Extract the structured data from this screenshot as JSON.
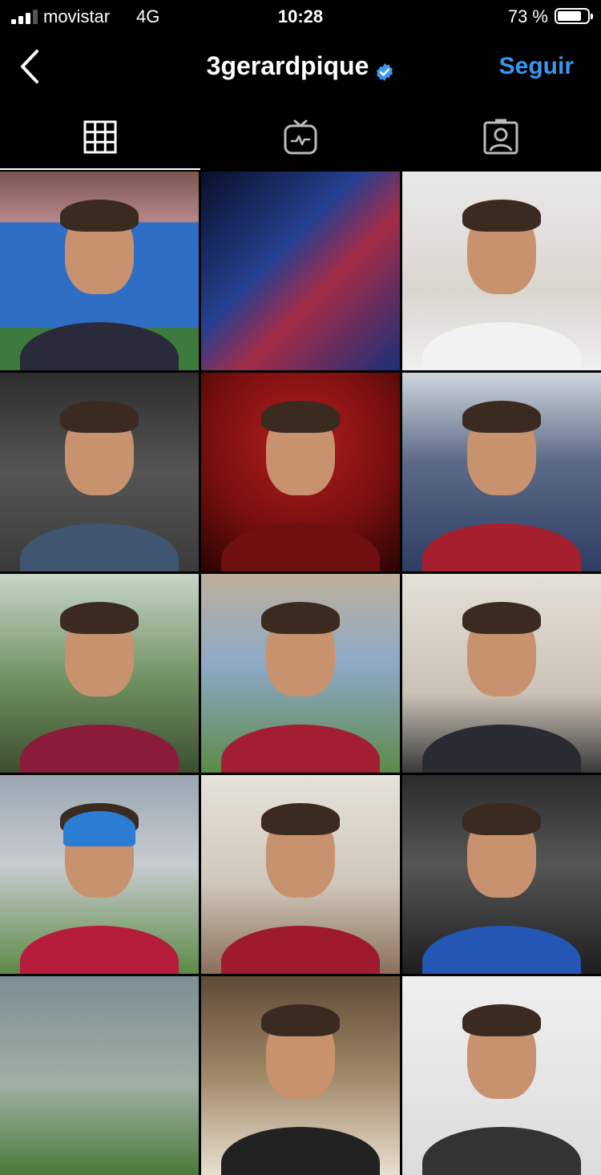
{
  "status_bar": {
    "carrier": "movistar",
    "network": "4G",
    "time": "10:28",
    "battery_pct": "73 %"
  },
  "header": {
    "username": "3gerardpique",
    "follow_label": "Seguir",
    "accent": "#3897f0"
  },
  "tabs": [
    {
      "name": "grid",
      "icon": "grid-icon",
      "active": true
    },
    {
      "name": "igtv",
      "icon": "tv-icon",
      "active": false
    },
    {
      "name": "tagged",
      "icon": "tagged-user-icon",
      "active": false
    }
  ],
  "grid": {
    "posts": [
      {
        "bg": "linear-gradient(180deg,#7a5550 0%,#b7868a 25%,#2f6ec5 26%,#2f6ec5 78%,#3c7a3d 79%)",
        "shirt": "#2a2a3a"
      },
      {
        "bg": "linear-gradient(135deg,#0a0f2a 0%,#24408f 40%,#a32c48 60%,#1b2f7a 100%)",
        "shirt": "#1e3b9a",
        "noface": true
      },
      {
        "bg": "linear-gradient(180deg,#e9e9e9 0%,#d9d6cf 60%,#efefef 100%)",
        "shirt": "#f2f2f2"
      },
      {
        "bg": "linear-gradient(180deg,#2d2d2d 0%,#555 50%,#3b3b3b 100%)",
        "shirt": "#3f5570"
      },
      {
        "bg": "radial-gradient(circle at 50% 35%,#b21e1e 0%,#7a0f0f 55%,#2a0303 100%)",
        "shirt": "#6e1010"
      },
      {
        "bg": "linear-gradient(180deg,#cfd5dd 0%,#5b6a86 45%,#2e3e64 100%)",
        "shirt": "#a61f2e"
      },
      {
        "bg": "linear-gradient(180deg,#c7d6c8 0%,#6e8f60 55%,#3b4e30 100%)",
        "shirt": "#8a1b3b"
      },
      {
        "bg": "linear-gradient(180deg,#bdb09a 0%,#8ea9c8 45%,#5c8a48 100%)",
        "shirt": "#a31d34"
      },
      {
        "bg": "linear-gradient(180deg,#e4e0d8 0%,#cbc2b6 60%,#3a3a3a 100%)",
        "shirt": "#2a2a33"
      },
      {
        "bg": "linear-gradient(180deg,#9aa6b2 0%,#c8ccd0 45%,#5d8a47 100%)",
        "shirt": "#b51d3a",
        "hat": true
      },
      {
        "bg": "linear-gradient(180deg,#e6e2da 0%,#cfc7ba 55%,#8a6f5a 100%)",
        "shirt": "#9e1a2f"
      },
      {
        "bg": "linear-gradient(180deg,#2b2b2b 0%,#565656 45%,#1e1e1e 100%)",
        "shirt": "#2456b4"
      },
      {
        "bg": "linear-gradient(180deg,#7d8e96 0%,#9fb0a4 55%,#4c7a3a 100%)",
        "shirt": "#333",
        "noface": true
      },
      {
        "bg": "linear-gradient(180deg,#5e4a36 0%,#a08868 50%,#e9e0d0 100%)",
        "shirt": "#222"
      },
      {
        "bg": "linear-gradient(180deg,#efefef 0%,#dcdcdc 100%)",
        "shirt": "#333"
      }
    ]
  }
}
